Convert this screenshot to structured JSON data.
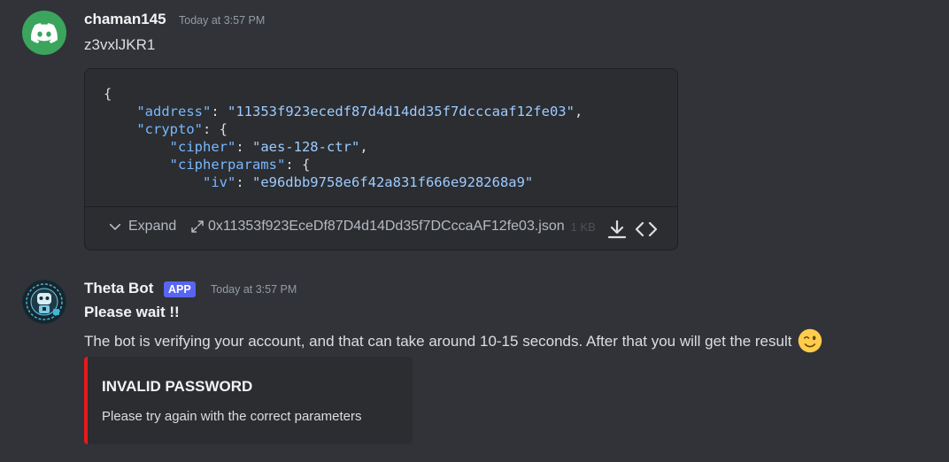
{
  "messages": [
    {
      "username": "chaman145",
      "timestamp": "Today at 3:57 PM",
      "text": "z3vxlJKR1",
      "avatar_icon": "discord-logo-icon",
      "avatar_color": "#3ba55d",
      "attachment": {
        "code_lines": [
          {
            "parts": [
              {
                "t": "{",
                "c": "punc"
              }
            ]
          },
          {
            "parts": [
              {
                "t": "    ",
                "c": "punc"
              },
              {
                "t": "\"address\"",
                "c": "key"
              },
              {
                "t": ": ",
                "c": "punc"
              },
              {
                "t": "\"11353f923ecedf87d4d14dd35f7dcccaaf12fe03\"",
                "c": "str"
              },
              {
                "t": ",",
                "c": "punc"
              }
            ]
          },
          {
            "parts": [
              {
                "t": "    ",
                "c": "punc"
              },
              {
                "t": "\"crypto\"",
                "c": "key"
              },
              {
                "t": ": {",
                "c": "punc"
              }
            ]
          },
          {
            "parts": [
              {
                "t": "        ",
                "c": "punc"
              },
              {
                "t": "\"cipher\"",
                "c": "key"
              },
              {
                "t": ": ",
                "c": "punc"
              },
              {
                "t": "\"aes-128-ctr\"",
                "c": "str"
              },
              {
                "t": ",",
                "c": "punc"
              }
            ]
          },
          {
            "parts": [
              {
                "t": "        ",
                "c": "punc"
              },
              {
                "t": "\"cipherparams\"",
                "c": "key"
              },
              {
                "t": ": {",
                "c": "punc"
              }
            ]
          },
          {
            "parts": [
              {
                "t": "            ",
                "c": "punc"
              },
              {
                "t": "\"iv\"",
                "c": "key"
              },
              {
                "t": ": ",
                "c": "punc"
              },
              {
                "t": "\"e96dbb9758e6f42a831f666e928268a9\"",
                "c": "str"
              }
            ]
          }
        ],
        "expand_label": "Expand",
        "file_name": "0x11353f923EceDf87D4d14Dd35f7DCccaAF12fe03.json",
        "file_size": "1 KB"
      }
    },
    {
      "username": "Theta Bot",
      "badge": "APP",
      "timestamp": "Today at 3:57 PM",
      "avatar_icon": "robot-avatar-icon",
      "bold_text": "Please wait !!",
      "text": "The bot is verifying your account, and that can take around 10-15 seconds. After that you will get the result",
      "emoji": "winking-face-emoji",
      "embed": {
        "title": "INVALID PASSWORD",
        "description": "Please try again with the correct parameters",
        "color": "#e81a1a"
      }
    }
  ],
  "colors": {
    "background": "#313338",
    "card": "#2b2d31",
    "badge": "#5865f2",
    "json_key": "#79b8ff",
    "json_string": "#9ecbff"
  }
}
